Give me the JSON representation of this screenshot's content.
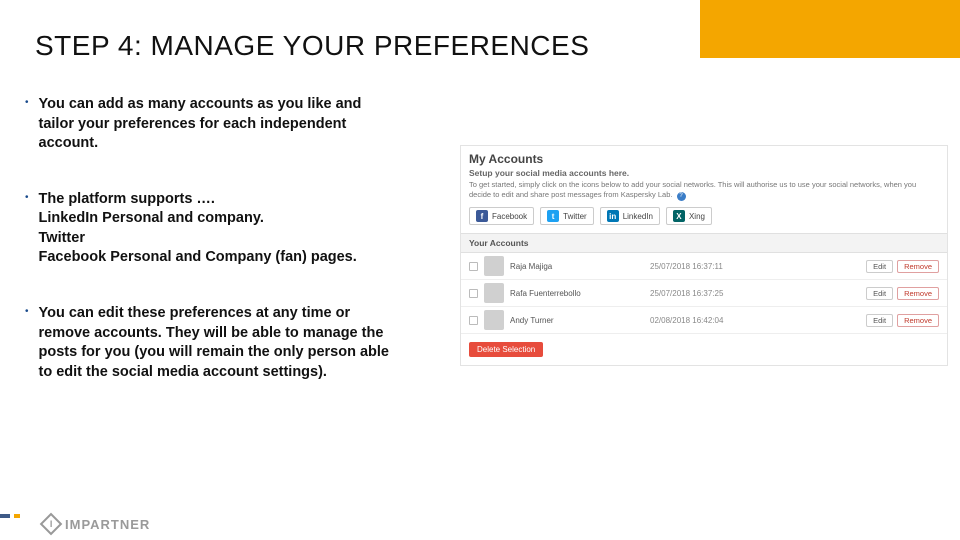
{
  "title": "STEP 4: MANAGE YOUR PREFERENCES",
  "bullets": [
    {
      "lines": [
        "You can add as many accounts as you like and",
        "tailor your preferences for each independent",
        "account."
      ]
    },
    {
      "lines": [
        "The platform supports ….",
        "LinkedIn Personal and company.",
        "Twitter",
        "Facebook Personal and Company (fan) pages."
      ]
    },
    {
      "lines": [
        "You can edit these preferences at any time or",
        "remove accounts. They will be able to manage the",
        "posts for you (you will remain the only person able",
        "to edit the social media account settings)."
      ]
    }
  ],
  "panel": {
    "heading": "My Accounts",
    "subtitle": "Setup your social media accounts here.",
    "helper": "To get started, simply click on the icons below to add your social networks. This will authorise us to use your social networks, when you decide to edit and share post messages from Kaspersky Lab.",
    "help_icon": "?",
    "social": [
      {
        "name": "Facebook",
        "glyph": "f",
        "cls": "fb"
      },
      {
        "name": "Twitter",
        "glyph": "t",
        "cls": "tw"
      },
      {
        "name": "LinkedIn",
        "glyph": "in",
        "cls": "li"
      },
      {
        "name": "Xing",
        "glyph": "X",
        "cls": "xg"
      }
    ],
    "accounts_header": "Your Accounts",
    "accounts": [
      {
        "name": "Raja Majiga",
        "ts": "25/07/2018 16:37:11"
      },
      {
        "name": "Rafa Fuenterrebollo",
        "ts": "25/07/2018 16:37:25"
      },
      {
        "name": "Andy Turner",
        "ts": "02/08/2018 16:42:04"
      }
    ],
    "edit_label": "Edit",
    "remove_label": "Remove",
    "delete_label": "Delete Selection"
  },
  "brand": "IMPARTNER",
  "brand_glyph": "I"
}
